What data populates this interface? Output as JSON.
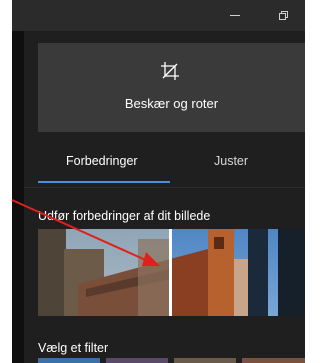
{
  "window": {
    "minimize_icon": "minimize-icon",
    "restore_icon": "restore-icon",
    "close_icon": "close-icon",
    "close_glyph": "✕"
  },
  "crop": {
    "icon": "crop-icon",
    "label": "Beskær og roter"
  },
  "tabs": [
    {
      "label": "Forbedringer",
      "selected": true
    },
    {
      "label": "Juster",
      "selected": false
    }
  ],
  "enhance": {
    "label": "Udfør forbedringer af dit billede"
  },
  "filter": {
    "label": "Vælg et filter"
  },
  "colors": {
    "panel_bg": "#1f1f1f",
    "card_bg": "#3a3a3a",
    "accent": "#4a90d9",
    "annotation_arrow": "#e0201b"
  }
}
